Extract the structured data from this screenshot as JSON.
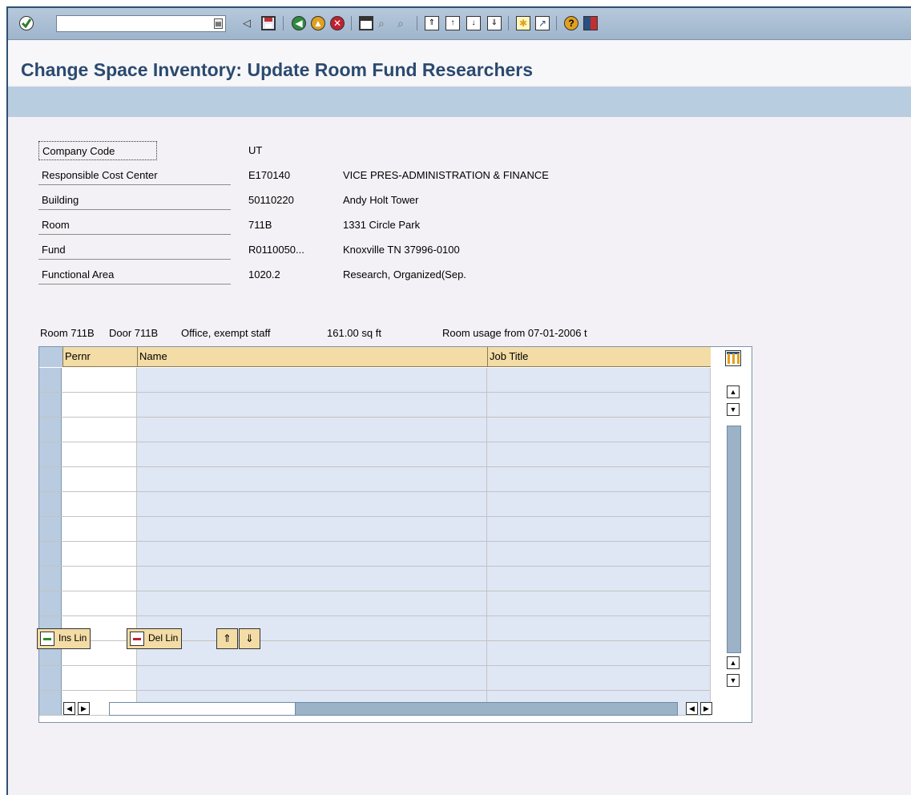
{
  "toolbar": {
    "command_value": "",
    "icons": [
      "enter-icon",
      "command-dropdown-icon",
      "back-arrow-icon",
      "save-icon",
      "back-icon",
      "exit-icon",
      "cancel-icon",
      "print-icon",
      "find-icon",
      "find-next-icon",
      "first-page-icon",
      "previous-page-icon",
      "next-page-icon",
      "last-page-icon",
      "create-session-icon",
      "shortcut-icon",
      "help-icon",
      "layout-menu-icon"
    ]
  },
  "title": "Change Space Inventory: Update Room Fund Researchers",
  "fields": [
    {
      "label": "Company Code",
      "value": "UT",
      "description": ""
    },
    {
      "label": "Responsible Cost Center",
      "value": "E170140",
      "description": "VICE PRES-ADMINISTRATION & FINANCE"
    },
    {
      "label": "Building",
      "value": "50110220",
      "description": "Andy Holt Tower"
    },
    {
      "label": "Room",
      "value": "711B",
      "description": "1331 Circle Park"
    },
    {
      "label": "Fund",
      "value": "R0110050...",
      "description": "Knoxville TN 37996-0100"
    },
    {
      "label": "Functional Area",
      "value": "1020.2",
      "description": "Research, Organized(Sep."
    }
  ],
  "room_info": {
    "room": "Room 711B",
    "door": "Door 711B",
    "usage_type": "Office, exempt staff",
    "area": "161.00 sq ft",
    "usage_from": "Room usage from 07-01-2006 t"
  },
  "table": {
    "columns": [
      "Pernr",
      "Name",
      "Job Title"
    ],
    "row_count": 14
  },
  "buttons": {
    "insert_line": "Ins Lin",
    "delete_line": "Del Lin",
    "page_up_icon": "page-up-icon",
    "page_down_icon": "page-down-icon"
  },
  "colors": {
    "toolbar": "#9fb5cc",
    "title": "#2b4a6f",
    "table_header": "#f3dca5",
    "input_cell": "#dfe6f4"
  }
}
